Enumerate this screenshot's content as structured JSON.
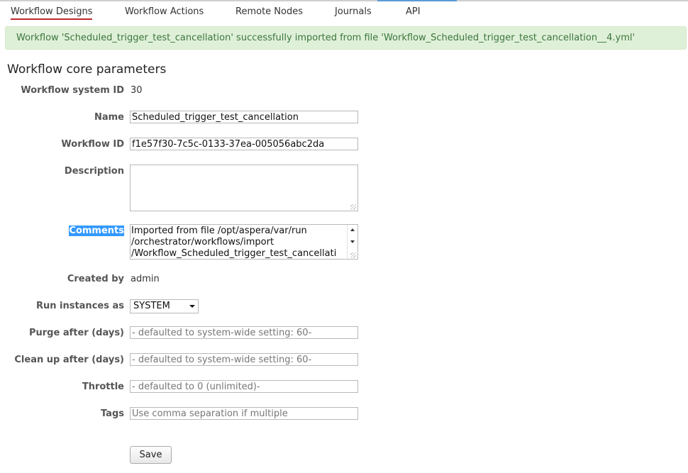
{
  "nav": {
    "tabs": [
      {
        "label": "Workflow Designs",
        "active": true
      },
      {
        "label": "Workflow Actions"
      },
      {
        "label": "Remote Nodes"
      },
      {
        "label": "Journals"
      },
      {
        "label": "API"
      }
    ]
  },
  "alert": {
    "message": "Workflow 'Scheduled_trigger_test_cancellation' successfully imported from file 'Workflow_Scheduled_trigger_test_cancellation__4.yml'"
  },
  "form": {
    "title": "Workflow core parameters",
    "system_id": {
      "label": "Workflow system ID",
      "value": "30"
    },
    "name": {
      "label": "Name",
      "value": "Scheduled_trigger_test_cancellation"
    },
    "workflow_id": {
      "label": "Workflow ID",
      "value": "f1e57f30-7c5c-0133-37ea-005056abc2da"
    },
    "description": {
      "label": "Description",
      "value": ""
    },
    "comments": {
      "label": "Comments",
      "lines": [
        "Imported from file /opt/aspera/var/run",
        "/orchestrator/workflows/import",
        "/Workflow_Scheduled_trigger_test_cancellati"
      ]
    },
    "created_by": {
      "label": "Created by",
      "value": "admin"
    },
    "run_as": {
      "label": "Run instances as",
      "selected": "SYSTEM"
    },
    "purge": {
      "label": "Purge after (days)",
      "placeholder": "- defaulted to system-wide setting: 60-"
    },
    "cleanup": {
      "label": "Clean up after (days)",
      "placeholder": "- defaulted to system-wide setting: 60-"
    },
    "throttle": {
      "label": "Throttle",
      "placeholder": "- defaulted to 0 (unlimited)-"
    },
    "tags": {
      "label": "Tags",
      "placeholder": "Use comma separation if multiple"
    },
    "save_label": "Save"
  },
  "colors": {
    "active_tab_underline": "#c0272d",
    "alert_bg": "#dff0d8",
    "alert_text": "#3c763d",
    "selection": "#3399ff"
  }
}
